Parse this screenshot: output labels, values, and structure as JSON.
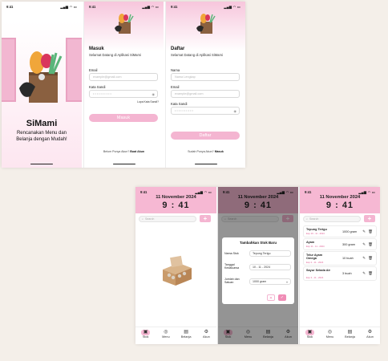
{
  "status_time": "9:41",
  "status_signal": "▂▄▆ ◠ ▭",
  "splash": {
    "app_name": "SiMami",
    "tagline_line1": "Rencanakan Menu dan",
    "tagline_line2": "Belanja dengan Mudah!"
  },
  "login": {
    "title": "Masuk",
    "subtitle": "Selamat Datang di Aplikasi SiMami",
    "email_label": "Email",
    "email_placeholder": "example@gmail.com",
    "password_label": "Kata Sandi",
    "password_placeholder": "• • • • • • • • • •",
    "forgot": "Lupa Kata Sandi?",
    "submit": "Masuk",
    "footer_text": "Belum Punya Akun?",
    "footer_link": "Buat Akun"
  },
  "register": {
    "title": "Daftar",
    "subtitle": "Selamat Datang di Aplikasi SiMami",
    "name_label": "Nama",
    "name_placeholder": "Nama Lengkap",
    "email_label": "Email",
    "email_placeholder": "example@gmail.com",
    "password_label": "Kata Sandi",
    "password_placeholder": "• • • • • • • • • •",
    "submit": "Daftar",
    "footer_text": "Sudah Punya Akun?",
    "footer_link": "Masuk"
  },
  "header": {
    "date": "11 November 2024",
    "time": "9 : 41"
  },
  "search_placeholder": "Search",
  "add_label": "+",
  "nav": [
    {
      "label": "Stok",
      "icon": "box-icon"
    },
    {
      "label": "Menu",
      "icon": "menu-icon"
    },
    {
      "label": "Belanja",
      "icon": "cart-icon"
    },
    {
      "label": "Akun",
      "icon": "gear-icon"
    }
  ],
  "modal": {
    "title": "Tambahkan Stok Baru",
    "name_label": "Nama Stok",
    "name_value": "Tepung Terigu",
    "date_label": "Tanggal Kedaluarsa",
    "date_value": "10 - 11 - 2024",
    "amount_label": "Jumlah dan Satuan",
    "amount_value": "1000 gram",
    "cancel": "✕",
    "confirm": "✓"
  },
  "stock_items": [
    {
      "name": "Tepung Terigu",
      "date": "Exp 10 - 11 - 2024",
      "qty": "1000 gram"
    },
    {
      "name": "Ayam",
      "date": "Exp 11 - 11 - 2024",
      "qty": "300 gram"
    },
    {
      "name": "Telur Ayam Omega",
      "date": "Exp 2 - 11 - 2024",
      "qty": "10 buah"
    },
    {
      "name": "Sayur Selada Air",
      "date": "Exp 3 - 11 - 2024",
      "qty": "3 buah"
    }
  ],
  "item_actions": "✎ 🗑",
  "colors": {
    "accent": "#f6b8d3",
    "button": "#f4b5d1",
    "background": "#f4efe9"
  }
}
